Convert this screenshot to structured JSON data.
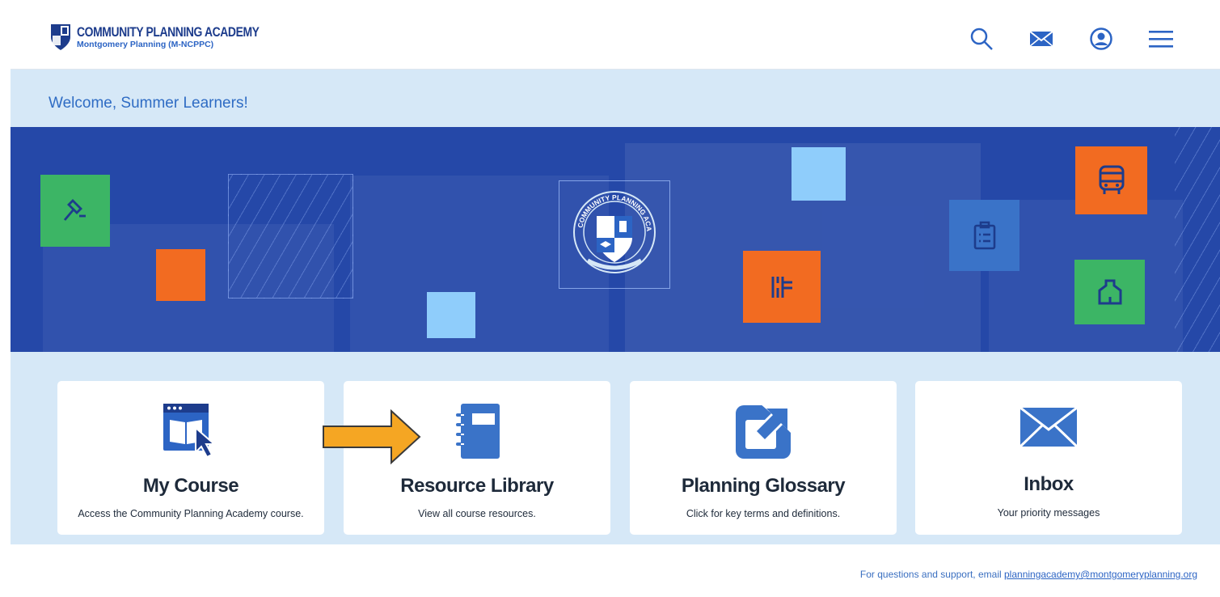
{
  "header": {
    "logo_title": "COMMUNITY PLANNING ACADEMY",
    "logo_subtitle": "Montgomery Planning  (M-NCPPC)",
    "icons": [
      "search-icon",
      "mail-icon",
      "user-account-icon",
      "hamburger-menu-icon"
    ]
  },
  "welcome": {
    "text": "Welcome, Summer Learners!"
  },
  "banner": {
    "seal_text": "COMMUNITY PLANNING ACADEMY",
    "colors": {
      "background": "#2548a8",
      "green": "#3cb565",
      "orange": "#f26b21",
      "light_blue": "#8fcdfb",
      "mid_blue": "#3a73c8"
    },
    "icons": [
      "gavel-icon",
      "building-floorplan-icon",
      "clipboard-icon",
      "bus-icon",
      "house-outline-icon"
    ]
  },
  "cards": [
    {
      "title": "My Course",
      "description": "Access the Community Planning Academy course.",
      "icon": "course-book-cursor-icon"
    },
    {
      "title": "Resource Library",
      "description": "View all course resources.",
      "icon": "notebook-icon"
    },
    {
      "title": "Planning Glossary",
      "description": "Click for key terms and definitions.",
      "icon": "external-link-icon"
    },
    {
      "title": "Inbox",
      "description": "Your priority messages",
      "icon": "envelope-icon"
    }
  ],
  "annotation": {
    "icon": "yellow-arrow-pointer",
    "color": "#f5a623"
  },
  "footer": {
    "prefix": "For questions and support, email ",
    "email": "planningacademy@montgomeryplanning.org"
  },
  "theme": {
    "accent": "#2f6cc4",
    "light_bg": "#d6e8f7",
    "text_dark": "#1e2a3a"
  }
}
